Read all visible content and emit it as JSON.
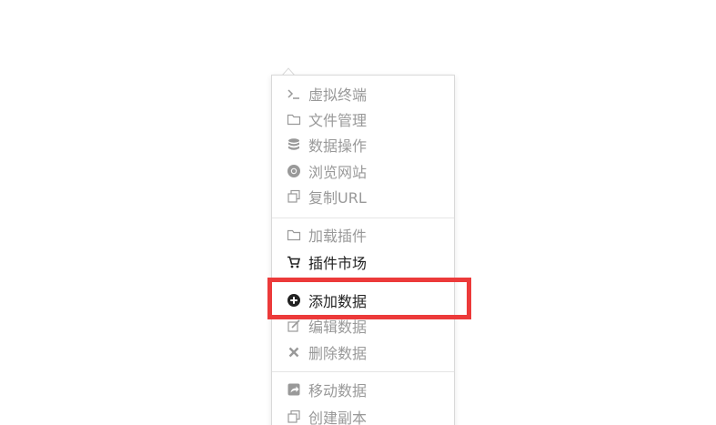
{
  "context_menu": {
    "group1": [
      {
        "label": "虚拟终端",
        "icon": "terminal-icon"
      },
      {
        "label": "文件管理",
        "icon": "folder-icon"
      },
      {
        "label": "数据操作",
        "icon": "database-icon"
      },
      {
        "label": "浏览网站",
        "icon": "chrome-icon"
      },
      {
        "label": "复制URL",
        "icon": "copy-icon"
      }
    ],
    "group2": [
      {
        "label": "加载插件",
        "icon": "folder-icon"
      },
      {
        "label": "插件市场",
        "icon": "cart-icon"
      }
    ],
    "group3": [
      {
        "label": "添加数据",
        "icon": "plus-circle-icon"
      },
      {
        "label": "编辑数据",
        "icon": "edit-icon"
      },
      {
        "label": "删除数据",
        "icon": "close-icon"
      }
    ],
    "group4": [
      {
        "label": "移动数据",
        "icon": "share-icon"
      },
      {
        "label": "创建副本",
        "icon": "copy-icon"
      }
    ]
  },
  "colors": {
    "disabled_text": "#999999",
    "active_text": "#222222",
    "highlight_border": "#ec3a3a"
  }
}
